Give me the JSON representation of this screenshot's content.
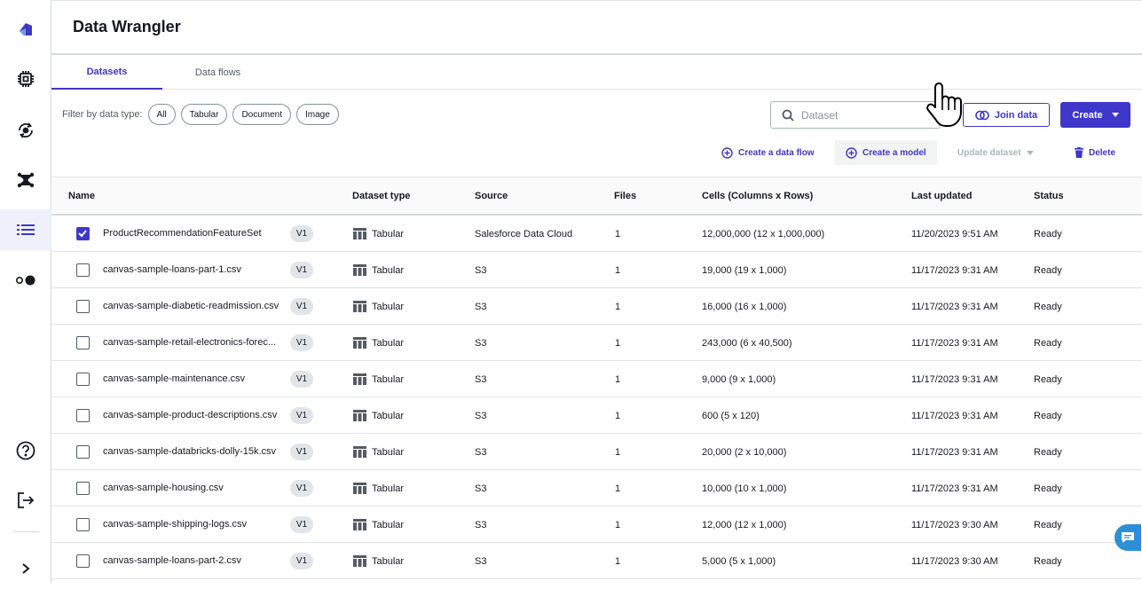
{
  "app": {
    "title": "Data Wrangler"
  },
  "sidebar": {
    "items": [
      {
        "icon": "canvas-logo-icon"
      },
      {
        "icon": "chip-icon"
      },
      {
        "icon": "model-cycle-icon"
      },
      {
        "icon": "gen-ai-icon"
      },
      {
        "icon": "list-icon"
      },
      {
        "icon": "toggle-icon"
      }
    ],
    "bottom": [
      {
        "icon": "help-icon"
      },
      {
        "icon": "sign-out-icon"
      },
      {
        "icon": "expand-icon"
      }
    ]
  },
  "tabs": [
    {
      "label": "Datasets",
      "active": true
    },
    {
      "label": "Data flows",
      "active": false
    }
  ],
  "filter": {
    "label": "Filter by data type:",
    "chips": [
      "All",
      "Tabular",
      "Document",
      "Image"
    ]
  },
  "search": {
    "placeholder": "Dataset"
  },
  "buttons": {
    "join": "Join data",
    "create": "Create"
  },
  "actions": {
    "create_flow": "Create a data flow",
    "create_model": "Create a model",
    "update_dataset": "Update dataset",
    "delete": "Delete"
  },
  "table": {
    "columns": [
      "Name",
      "Dataset type",
      "Source",
      "Files",
      "Cells (Columns x Rows)",
      "Last updated",
      "Status"
    ],
    "rows": [
      {
        "checked": true,
        "name": "ProductRecommendationFeatureSet",
        "version": "V1",
        "type": "Tabular",
        "source": "Salesforce Data Cloud",
        "files": "1",
        "cells": "12,000,000 (12 x 1,000,000)",
        "updated": "11/20/2023 9:51 AM",
        "status": "Ready"
      },
      {
        "checked": false,
        "name": "canvas-sample-loans-part-1.csv",
        "version": "V1",
        "type": "Tabular",
        "source": "S3",
        "files": "1",
        "cells": "19,000 (19 x 1,000)",
        "updated": "11/17/2023 9:31 AM",
        "status": "Ready"
      },
      {
        "checked": false,
        "name": "canvas-sample-diabetic-readmission.csv",
        "version": "V1",
        "type": "Tabular",
        "source": "S3",
        "files": "1",
        "cells": "16,000 (16 x 1,000)",
        "updated": "11/17/2023 9:31 AM",
        "status": "Ready"
      },
      {
        "checked": false,
        "name": "canvas-sample-retail-electronics-forec...",
        "version": "V1",
        "type": "Tabular",
        "source": "S3",
        "files": "1",
        "cells": "243,000 (6 x 40,500)",
        "updated": "11/17/2023 9:31 AM",
        "status": "Ready"
      },
      {
        "checked": false,
        "name": "canvas-sample-maintenance.csv",
        "version": "V1",
        "type": "Tabular",
        "source": "S3",
        "files": "1",
        "cells": "9,000 (9 x 1,000)",
        "updated": "11/17/2023 9:31 AM",
        "status": "Ready"
      },
      {
        "checked": false,
        "name": "canvas-sample-product-descriptions.csv",
        "version": "V1",
        "type": "Tabular",
        "source": "S3",
        "files": "1",
        "cells": "600 (5 x 120)",
        "updated": "11/17/2023 9:31 AM",
        "status": "Ready"
      },
      {
        "checked": false,
        "name": "canvas-sample-databricks-dolly-15k.csv",
        "version": "V1",
        "type": "Tabular",
        "source": "S3",
        "files": "1",
        "cells": "20,000 (2 x 10,000)",
        "updated": "11/17/2023 9:31 AM",
        "status": "Ready"
      },
      {
        "checked": false,
        "name": "canvas-sample-housing.csv",
        "version": "V1",
        "type": "Tabular",
        "source": "S3",
        "files": "1",
        "cells": "10,000 (10 x 1,000)",
        "updated": "11/17/2023 9:31 AM",
        "status": "Ready"
      },
      {
        "checked": false,
        "name": "canvas-sample-shipping-logs.csv",
        "version": "V1",
        "type": "Tabular",
        "source": "S3",
        "files": "1",
        "cells": "12,000 (12 x 1,000)",
        "updated": "11/17/2023 9:30 AM",
        "status": "Ready"
      },
      {
        "checked": false,
        "name": "canvas-sample-loans-part-2.csv",
        "version": "V1",
        "type": "Tabular",
        "source": "S3",
        "files": "1",
        "cells": "5,000 (5 x 1,000)",
        "updated": "11/17/2023 9:30 AM",
        "status": "Ready"
      }
    ]
  },
  "colors": {
    "accent": "#3f37c9",
    "chat": "#2d8fd5"
  }
}
